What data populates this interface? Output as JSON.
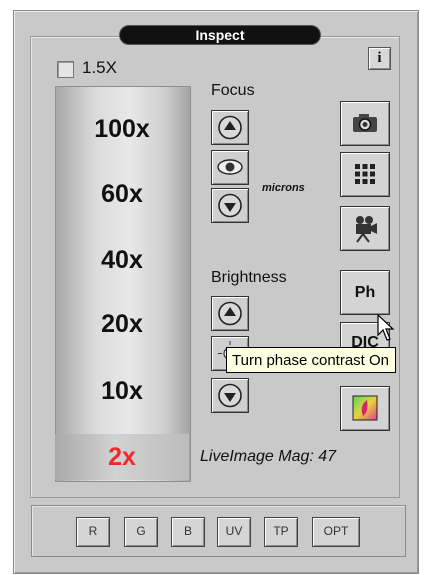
{
  "window": {
    "title": "Inspect"
  },
  "info_label": "i",
  "checkbox": {
    "label": "1.5X",
    "checked": false
  },
  "magnifications": [
    "100x",
    "60x",
    "40x",
    "20x",
    "10x",
    "2x"
  ],
  "selected_magnification": "2x",
  "focus": {
    "label": "Focus",
    "units": "microns"
  },
  "brightness": {
    "label": "Brightness"
  },
  "tools": {
    "phase_label": "Ph",
    "dic_label": "DIC"
  },
  "tooltip": "Turn phase contrast On",
  "live_image_mag": "LiveImage Mag: 47",
  "filters": [
    "R",
    "G",
    "B",
    "UV",
    "TP",
    "OPT"
  ],
  "colors": {
    "selected_mag": "#f02a2a",
    "tooltip_bg": "#ffffe1",
    "panel": "#c9c9c9"
  },
  "icons": [
    "camera-icon",
    "grid-icon",
    "movie-camera-icon",
    "color-map-icon",
    "up-arrow-icon",
    "down-arrow-icon",
    "eye-icon",
    "sun-icon",
    "mouse-pointer-icon"
  ]
}
